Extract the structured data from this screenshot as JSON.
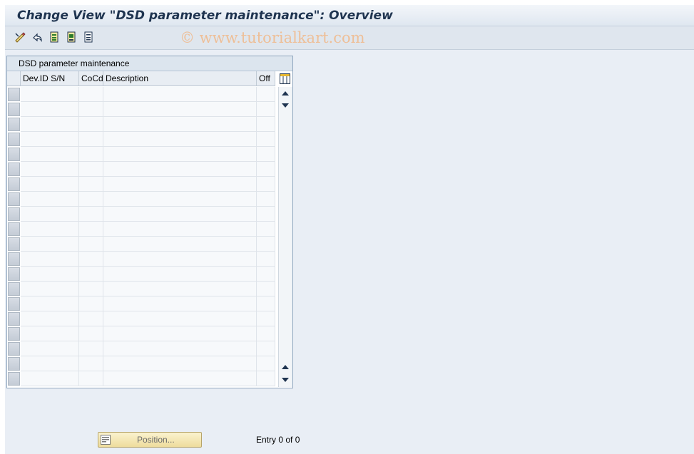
{
  "window": {
    "title": "Change View \"DSD parameter maintenance\": Overview"
  },
  "toolbar": {
    "icons": [
      "display-change-icon",
      "undo-icon",
      "select-all-icon",
      "select-block-icon",
      "deselect-all-icon"
    ],
    "watermark": "© www.tutorialkart.com"
  },
  "table": {
    "title": "DSD parameter maintenance",
    "columns": [
      "Dev.ID S/N",
      "CoCd",
      "Description",
      "Off"
    ],
    "row_count": 20,
    "rows": []
  },
  "footer": {
    "position_button": "Position...",
    "entry_text": "Entry 0 of 0"
  },
  "colors": {
    "title_text": "#1f3450",
    "background": "#e9eef5",
    "button_yellow": "#eedc9c"
  }
}
